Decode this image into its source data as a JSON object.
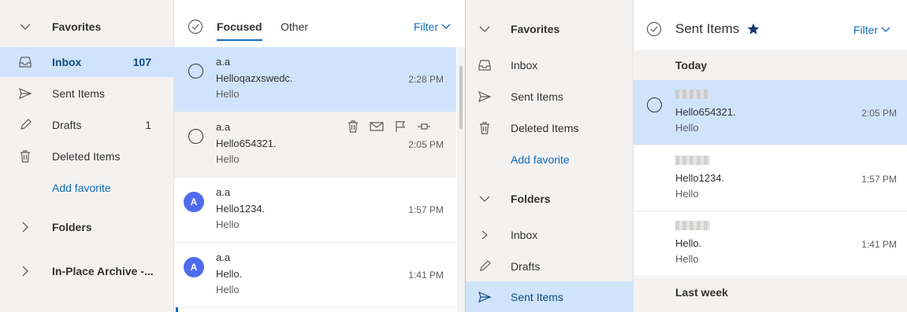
{
  "left": {
    "nav": {
      "favorites_label": "Favorites",
      "items": [
        {
          "label": "Inbox",
          "count": "107",
          "icon": "inbox-icon"
        },
        {
          "label": "Sent Items",
          "count": "",
          "icon": "send-icon"
        },
        {
          "label": "Drafts",
          "count": "1",
          "icon": "pencil-icon"
        },
        {
          "label": "Deleted Items",
          "count": "",
          "icon": "trash-icon"
        }
      ],
      "add_favorite": "Add favorite",
      "folders_label": "Folders",
      "archive_label": "In-Place Archive -..."
    },
    "list": {
      "tabs": [
        {
          "label": "Focused"
        },
        {
          "label": "Other"
        }
      ],
      "filter_label": "Filter",
      "messages": [
        {
          "sender": "a.a",
          "subject": "Helloqazxswedc.",
          "preview": "Hello",
          "time": "2:28 PM",
          "avatar": ""
        },
        {
          "sender": "a.a",
          "subject": "Hello654321.",
          "preview": "Hello",
          "time": "2:05 PM",
          "avatar": ""
        },
        {
          "sender": "a.a",
          "subject": "Hello1234.",
          "preview": "Hello",
          "time": "1:57 PM",
          "avatar": "A"
        },
        {
          "sender": "a.a",
          "subject": "Hello.",
          "preview": "Hello",
          "time": "1:41 PM",
          "avatar": "A"
        }
      ]
    }
  },
  "right": {
    "nav": {
      "favorites_label": "Favorites",
      "favorites": [
        {
          "label": "Inbox",
          "icon": "inbox-icon"
        },
        {
          "label": "Sent Items",
          "icon": "send-icon"
        },
        {
          "label": "Deleted Items",
          "icon": "trash-icon"
        }
      ],
      "add_favorite": "Add favorite",
      "folders_label": "Folders",
      "folders": [
        {
          "label": "Inbox",
          "icon": "chevron-right-icon"
        },
        {
          "label": "Drafts",
          "icon": "pencil-icon"
        },
        {
          "label": "Sent Items",
          "icon": "send-icon"
        }
      ]
    },
    "list": {
      "folder_title": "Sent Items",
      "filter_label": "Filter",
      "group_today": "Today",
      "group_last_week": "Last week",
      "messages": [
        {
          "subject": "Hello654321.",
          "preview": "Hello",
          "time": "2:05 PM"
        },
        {
          "subject": "Hello1234.",
          "preview": "Hello",
          "time": "1:57 PM"
        },
        {
          "subject": "Hello.",
          "preview": "Hello",
          "time": "1:41 PM"
        }
      ]
    }
  },
  "colors": {
    "accent": "#0f6cbd",
    "selected_bg": "#cfe4fa",
    "nav_bg": "#f3f2f1",
    "avatar": "#4f6bed"
  }
}
